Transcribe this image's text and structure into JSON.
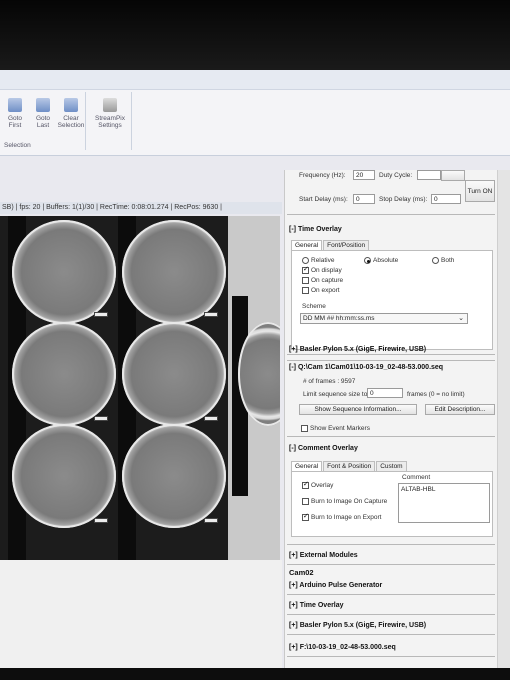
{
  "ribbon": {
    "buttons": [
      {
        "label1": "Goto",
        "label2": "First"
      },
      {
        "label1": "Goto",
        "label2": "Last"
      },
      {
        "label1": "Clear",
        "label2": "Selection"
      },
      {
        "label1": "StreamPix",
        "label2": "Settings"
      }
    ],
    "group_label": "Selection"
  },
  "video": {
    "status": "SB) | fps: 20 | Buffers: 1(1)/30 | RecTime: 0:08:01.274 | RecPos: 9630 |"
  },
  "panel": {
    "top": {
      "frequency_label": "Frequency (Hz):",
      "frequency_value": "20",
      "duty_label": "Duty Cycle:",
      "turn_on": "Turn ON",
      "start_delay_label": "Start Delay (ms):",
      "start_delay_value": "0",
      "stop_delay_label": "Stop Delay (ms):",
      "stop_delay_value": "0"
    },
    "time_overlay": {
      "header": "[-] Time Overlay",
      "tabs": [
        "General",
        "Font/Position"
      ],
      "radio_relative": "Relative",
      "radio_absolute": "Absolute",
      "radio_both": "Both",
      "on_display": "On display",
      "on_capture": "On capture",
      "on_export": "On export",
      "scheme_label": "Scheme",
      "scheme_value": "DD MM ## hh:mm:ss.ms"
    },
    "basler_header": "[+] Basler Pylon 5.x (GigE, Firewire, USB)",
    "sequence": {
      "header": "[-] Q:\\Cam 1\\Cam01\\10-03-19_02-48-53.000.seq",
      "frames": "# of frames : 9597",
      "limit_label": "Limit sequence size to",
      "limit_value": "0",
      "limit_suffix": "frames (0 = no limit)",
      "show_info": "Show Sequence Information...",
      "edit_desc": "Edit Description...",
      "show_events": "Show Event Markers"
    },
    "comment_overlay": {
      "header": "[-] Comment Overlay",
      "tabs": [
        "General",
        "Font & Position",
        "Custom"
      ],
      "overlay": "Overlay",
      "comment_label": "Comment",
      "comment_value": "ALTAB-HBL",
      "burn_capture": "Burn to Image On Capture",
      "burn_export": "Burn to Image on Export"
    },
    "external_modules": "[+] External Modules",
    "cam02": {
      "title": "Cam02",
      "items": [
        "[+] Arduino Pulse Generator",
        "[+] Time Overlay",
        "[+] Basler Pylon 5.x (GigE, Firewire, USB)",
        "[+] F:\\10-03-19_02-48-53.000.seq"
      ]
    }
  }
}
